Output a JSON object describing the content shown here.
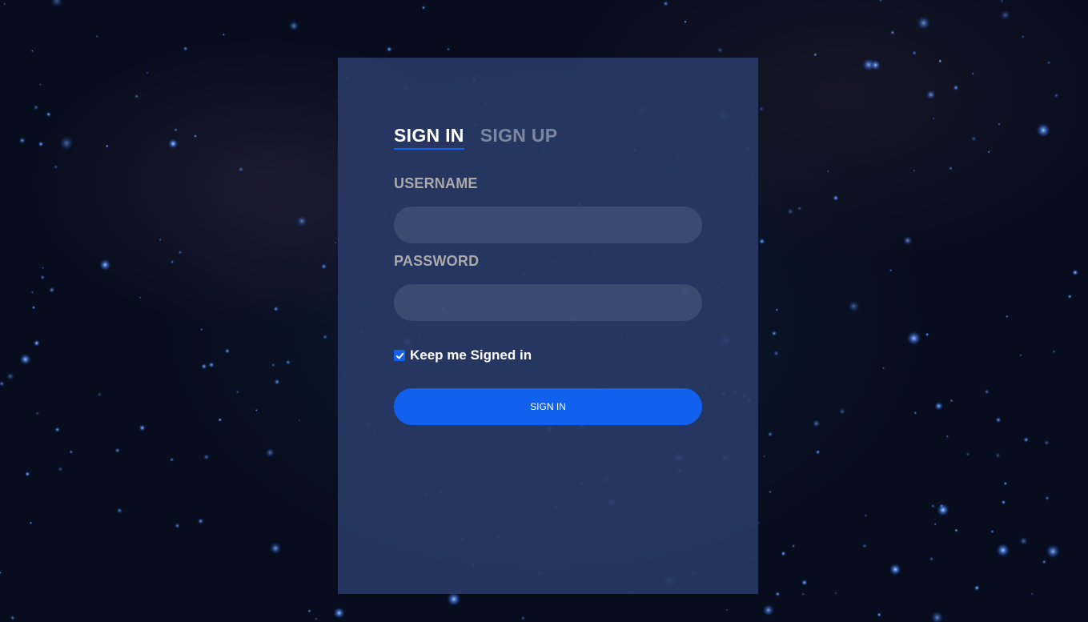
{
  "tabs": {
    "sign_in": "SIGN IN",
    "sign_up": "SIGN UP",
    "active": "sign_in"
  },
  "form": {
    "username_label": "USERNAME",
    "username_value": "",
    "password_label": "PASSWORD",
    "password_value": "",
    "keep_signed_in_label": "Keep me Signed in",
    "keep_signed_in_checked": true,
    "submit_label": "SIGN IN"
  },
  "colors": {
    "accent": "#1161ee",
    "card_bg": "#283965",
    "page_bg": "#070d1d",
    "label": "#aaaaaa",
    "inactive_tab": "#6b7794"
  },
  "icons": {
    "checkbox": "check-icon"
  }
}
